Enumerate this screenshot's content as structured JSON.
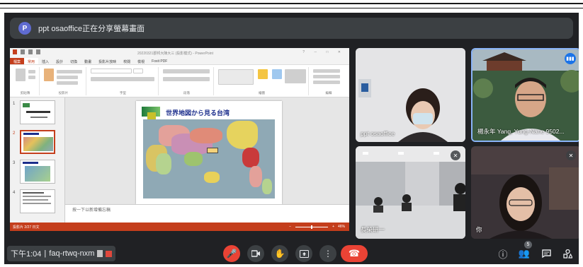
{
  "banner": {
    "avatar_letter": "P",
    "text": "ppt osaoffice正在分享螢幕畫面"
  },
  "ppt": {
    "window_title": "20220321郡邦大陳大三 (投影模式) - PowerPoint",
    "tabs": [
      "檔案",
      "常用",
      "插入",
      "設計",
      "切換",
      "動畫",
      "投影片放映",
      "校閱",
      "檢視",
      "Foxit PDF"
    ],
    "ribbon_groups": [
      "剪貼簿",
      "投影片",
      "字型",
      "段落",
      "繪圖",
      "編輯"
    ],
    "slide_numbers": [
      "1",
      "2",
      "3",
      "4"
    ],
    "slide_title": "世界地図から見る台湾",
    "notes_placeholder": "按一下以新增備忘稿",
    "status_left": "投影片 2/27   日文",
    "status_right": "46%"
  },
  "participants": [
    {
      "name": "ppt osaoffice",
      "muted": false
    },
    {
      "name": "楊永年 Yang, Yung-Nane 9502...",
      "muted": false,
      "speaking": true
    },
    {
      "name": "長榮研一",
      "muted": true
    },
    {
      "name": "你",
      "muted": true
    }
  ],
  "bottom": {
    "time": "下午1:04",
    "meeting_code": "faq-rtwq-nxm",
    "participant_count": "5"
  },
  "icons": {
    "mic": "mic-off-icon",
    "camera": "camera-icon",
    "hand": "raise-hand-icon",
    "present": "present-icon",
    "more": "more-icon",
    "hangup": "hang-up-icon",
    "info": "info-icon",
    "people": "people-icon",
    "chat": "chat-icon",
    "activities": "activities-icon"
  },
  "colors": {
    "stage": "#202124",
    "ppt_accent": "#c43e1c",
    "danger": "#ea4335",
    "active_border": "#8ab4f8"
  }
}
